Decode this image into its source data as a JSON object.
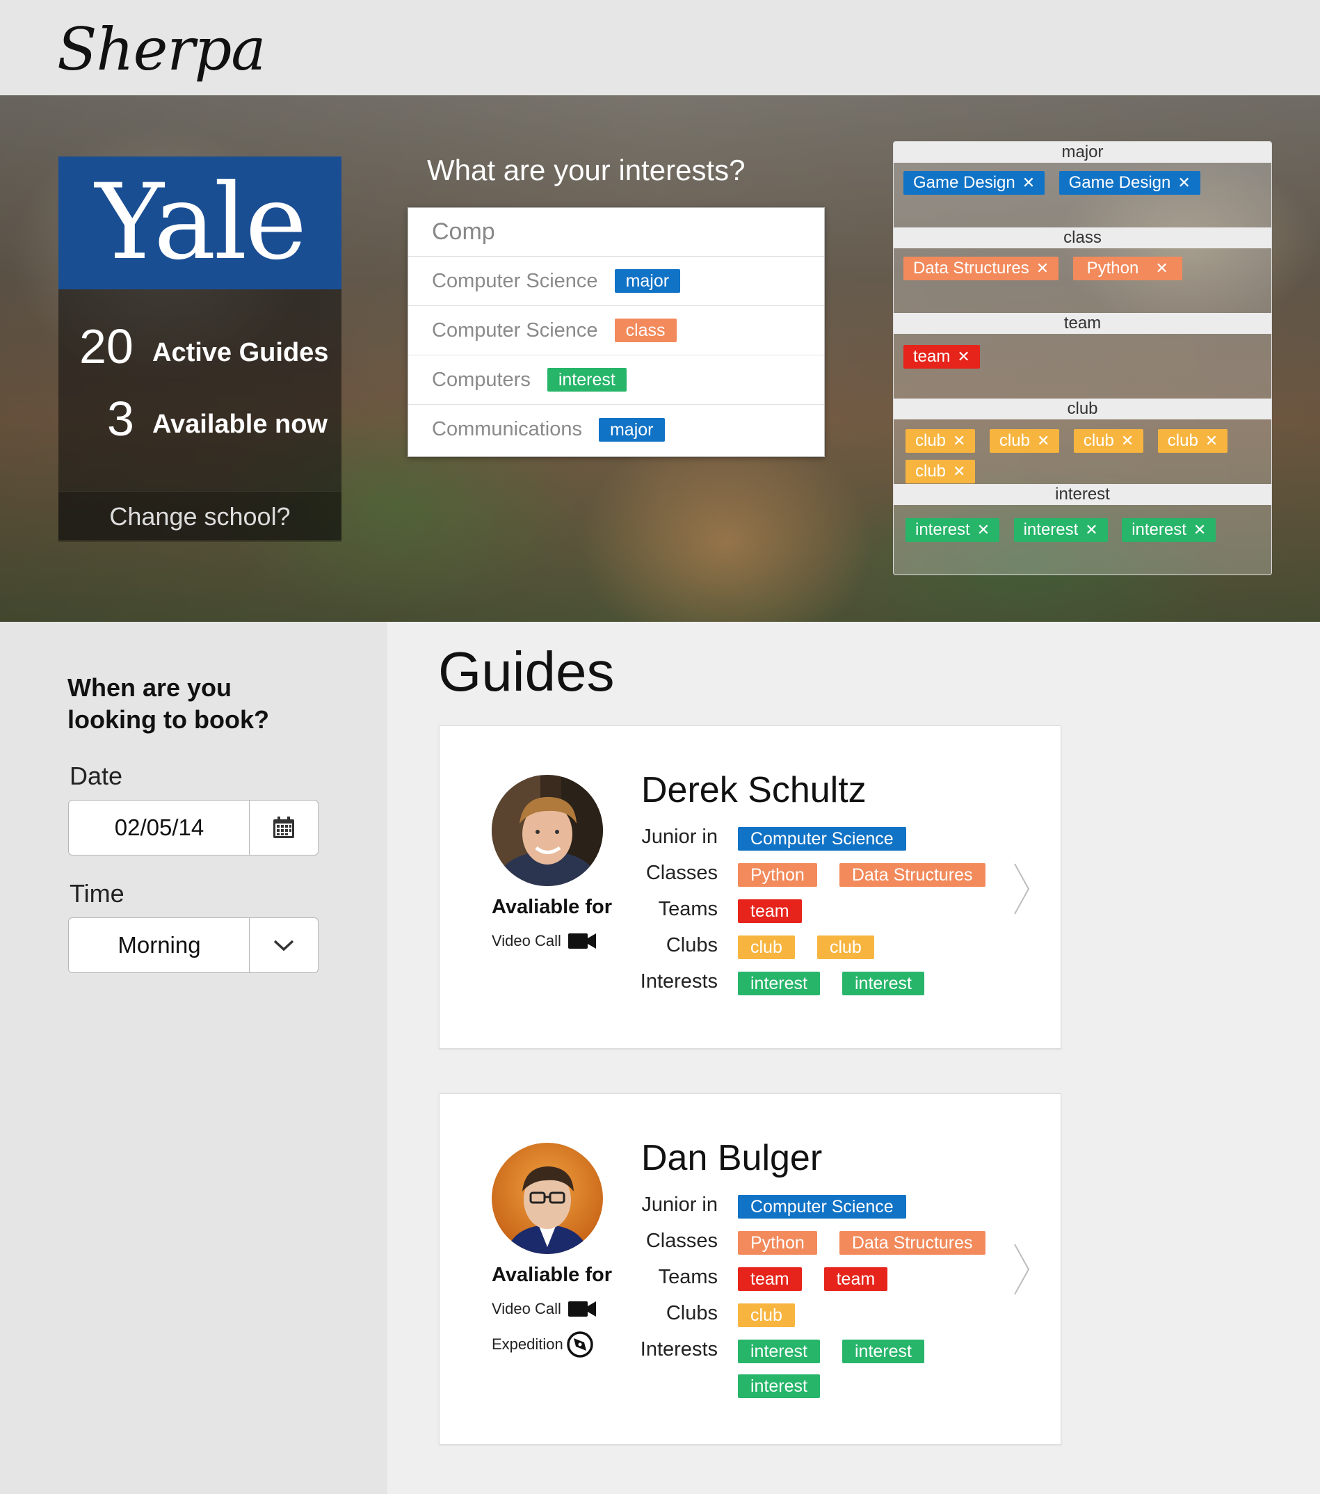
{
  "header": {
    "app_name": "Sherpa"
  },
  "school": {
    "name": "Yale",
    "logo_color": "#1a4e93",
    "active_guides_count": "20",
    "active_guides_label": "Active Guides",
    "available_count": "3",
    "available_label": "Available now",
    "change_school": "Change school?"
  },
  "interest_search": {
    "question": "What are your interests?",
    "query": "Comp",
    "suggestions": [
      {
        "text": "Computer Science",
        "tag": "major"
      },
      {
        "text": "Computer Science",
        "tag": "class"
      },
      {
        "text": "Computers",
        "tag": "interest"
      },
      {
        "text": "Communications",
        "tag": "major"
      }
    ]
  },
  "filters": {
    "remove_icon": "close-icon",
    "groups": [
      {
        "title": "major",
        "tags": [
          "Game Design",
          "Game Design"
        ]
      },
      {
        "title": "class",
        "tags": [
          "Data Structures",
          "Python"
        ]
      },
      {
        "title": "team",
        "tags": [
          "team"
        ]
      },
      {
        "title": "club",
        "tags": [
          "club",
          "club",
          "club",
          "club",
          "club"
        ]
      },
      {
        "title": "interest",
        "tags": [
          "interest",
          "interest",
          "interest"
        ]
      }
    ]
  },
  "colors": {
    "major": "#1173c6",
    "class": "#f28a5c",
    "team": "#e6241b",
    "club": "#f7b540",
    "interest": "#27b56a"
  },
  "booking": {
    "question": "When are you looking to book?",
    "date_label": "Date",
    "date_value": "02/05/14",
    "date_icon": "calendar-icon",
    "time_label": "Time",
    "time_value": "Morning",
    "time_icon": "chevron-down-icon"
  },
  "guides_title": "Guides",
  "row_labels": {
    "year": "Junior in",
    "classes": "Classes",
    "teams": "Teams",
    "clubs": "Clubs",
    "interests": "Interests"
  },
  "available_for_label": "Avaliable for",
  "guides": [
    {
      "name": "Derek Schultz",
      "major": "Computer Science",
      "classes": [
        "Python",
        "Data Structures"
      ],
      "teams": [
        "team"
      ],
      "clubs": [
        "club",
        "club"
      ],
      "interests": [
        "interest",
        "interest"
      ],
      "availability": [
        {
          "label": "Video Call",
          "icon": "video-camera-icon"
        }
      ]
    },
    {
      "name": "Dan Bulger",
      "major": "Computer Science",
      "classes": [
        "Python",
        "Data Structures"
      ],
      "teams": [
        "team",
        "team"
      ],
      "clubs": [
        "club"
      ],
      "interests": [
        "interest",
        "interest",
        "interest"
      ],
      "availability": [
        {
          "label": "Video Call",
          "icon": "video-camera-icon"
        },
        {
          "label": "Expedition",
          "icon": "compass-icon"
        }
      ]
    }
  ]
}
